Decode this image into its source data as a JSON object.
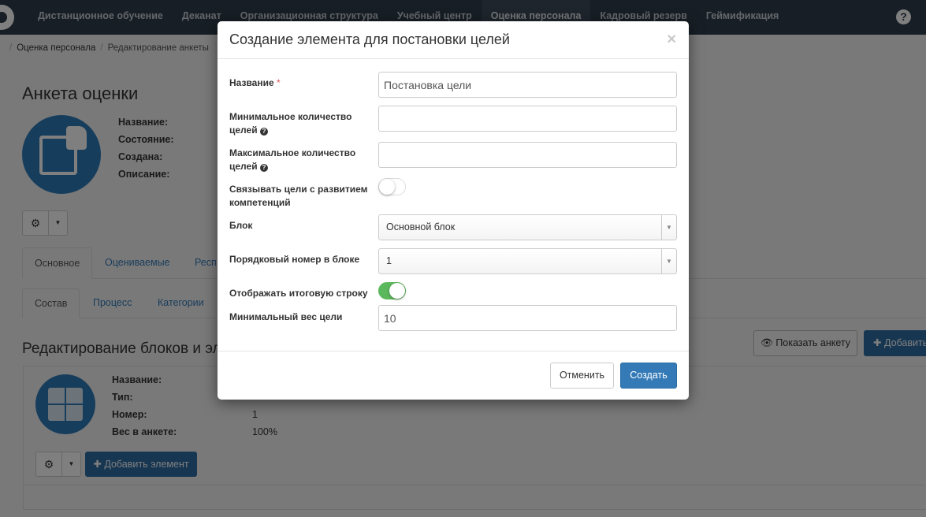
{
  "nav": {
    "items": [
      {
        "label": "Дистанционное обучение"
      },
      {
        "label": "Деканат"
      },
      {
        "label": "Организационная структура"
      },
      {
        "label": "Учебный центр"
      },
      {
        "label": "Оценка персонала"
      },
      {
        "label": "Кадровый резерв"
      },
      {
        "label": "Геймификация"
      }
    ],
    "help_icon": "?"
  },
  "breadcrumb": [
    "Оценка персонала",
    "Редактирование анкеты"
  ],
  "page": {
    "title": "Анкета оценки",
    "props": [
      "Название:",
      "Состояние:",
      "Создана:",
      "Описание:"
    ],
    "tabs": [
      "Основное",
      "Оцениваемые",
      "Респ"
    ],
    "subtabs": [
      "Состав",
      "Процесс",
      "Категории"
    ],
    "section_title": "Редактирование блоков и эле",
    "show_btn": "Показать анкету",
    "add_btn": "Добавить",
    "block": {
      "labels": [
        "Название:",
        "Тип:",
        "Номер:",
        "Вес в анкете:"
      ],
      "values": [
        "",
        "",
        "1",
        "100%"
      ],
      "add_element_btn": "Добавить элемент"
    }
  },
  "modal": {
    "title": "Создание элемента для постановки целей",
    "close": "×",
    "fields": {
      "name_label": "Название",
      "name_required": "*",
      "name_value": "Постановка цели",
      "min_label": "Минимальное количество целей",
      "max_label": "Максимальное количество целей",
      "link_label": "Связывать цели с развитием компетенций",
      "block_label": "Блок",
      "block_value": "Основной блок",
      "order_label": "Порядковый номер в блоке",
      "order_value": "1",
      "total_label": "Отображать итоговую строку",
      "weight_label": "Минимальный вес цели",
      "weight_value": "10"
    },
    "cancel": "Отменить",
    "create": "Создать",
    "toggles": {
      "link_competences": false,
      "show_total": true
    }
  },
  "colors": {
    "nav_bg": "#2f3c4b",
    "primary": "#337ab7",
    "toggle_on": "#5cb85c",
    "required": "#d9534f"
  },
  "icons": [
    "help-icon",
    "gear-icon",
    "caret-down-icon",
    "eye-icon",
    "plus-icon",
    "thumbs-up-card-icon",
    "puzzle-icon",
    "question-circle-icon",
    "close-icon"
  ]
}
